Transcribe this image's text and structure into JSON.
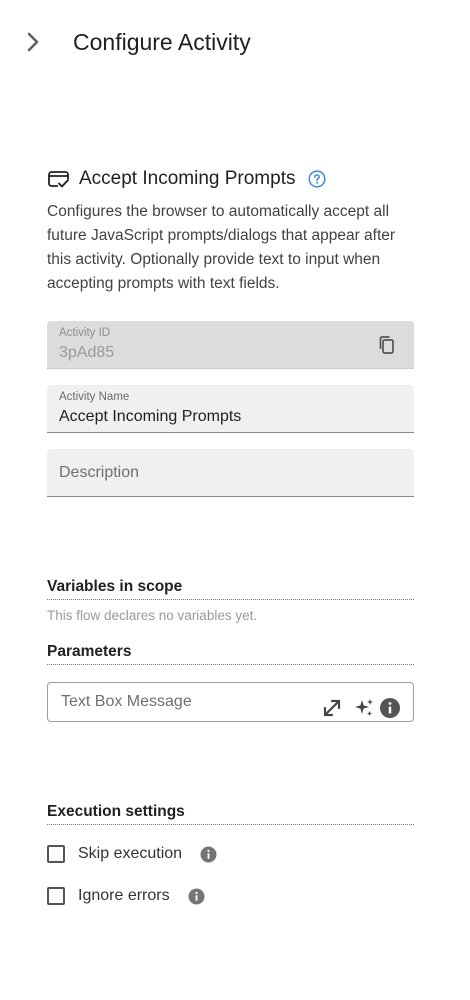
{
  "header": {
    "title": "Configure Activity",
    "collapse_icon": "chevron-right-icon"
  },
  "activity": {
    "icon": "checked-card-icon",
    "title": "Accept Incoming Prompts",
    "help_icon": "help-circle-icon",
    "description": "Configures the browser to automatically accept all future JavaScript prompts/dialogs that appear after this activity. Optionally provide text to input when accepting prompts with text fields."
  },
  "fields": {
    "activity_id": {
      "label": "Activity ID",
      "value": "3pAd85",
      "icon": "copy-icon"
    },
    "activity_name": {
      "label": "Activity Name",
      "value": "Accept Incoming Prompts"
    },
    "description": {
      "placeholder": "Description"
    }
  },
  "variables": {
    "title": "Variables in scope",
    "empty_note": "This flow declares no variables yet."
  },
  "parameters": {
    "title": "Parameters",
    "text_box_message": {
      "placeholder": "Text Box Message",
      "icons": [
        "expand-icon",
        "sparkles-icon",
        "info-icon"
      ]
    }
  },
  "execution": {
    "title": "Execution settings",
    "skip_execution": {
      "label": "Skip execution",
      "checked": false
    },
    "ignore_errors": {
      "label": "Ignore errors",
      "checked": false
    }
  },
  "colors": {
    "accent_help": "#4a90d9",
    "info_icon": "#757575"
  }
}
